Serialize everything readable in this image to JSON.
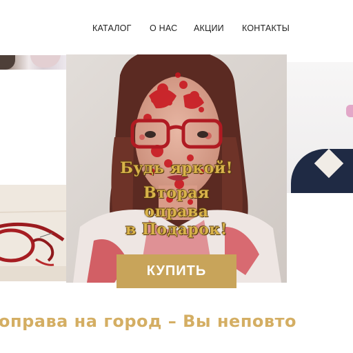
{
  "nav": {
    "items": [
      {
        "label": "КАТАЛОГ"
      },
      {
        "label": "О НАС"
      },
      {
        "label": "АКЦИИ"
      },
      {
        "label": "КОНТАКТЫ"
      }
    ]
  },
  "hero": {
    "promo_lines": [
      "Будь яркой!",
      "Вторая",
      "оправа",
      "в Подарок!"
    ],
    "buy_label": "КУПИТЬ"
  },
  "ticker": {
    "text": "оправа на город – Вы неповто"
  },
  "colors": {
    "accent": "#c8a45a",
    "ticker": "#d4ae63",
    "nav_text": "#1f1f1f"
  }
}
